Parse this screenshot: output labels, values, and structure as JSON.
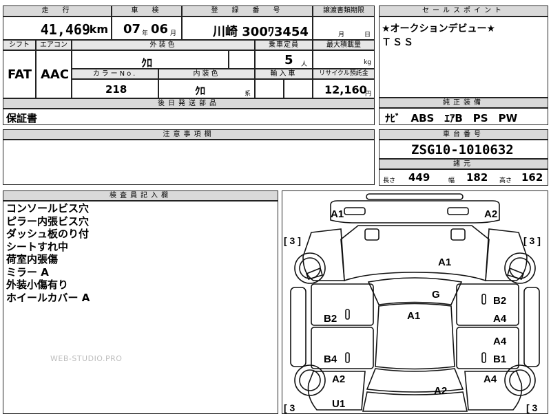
{
  "headers": {
    "mileage": "走　行",
    "inspection": "車　検",
    "registration": "登　録　番　号",
    "transfer_deadline": "譲渡書類期限",
    "sales_point": "セールスポイント",
    "shift": "シフト",
    "aircon": "エアコン",
    "exterior_color": "外装色",
    "capacity": "乗車定員",
    "max_load": "最大積載量",
    "color_no": "カラーNo.",
    "interior_color": "内装色",
    "import": "輸入車",
    "recycle": "リサイクル預託金",
    "follow_up_parts": "後日発送部品",
    "genuine_equipment": "純正装備",
    "notes": "注意事項欄",
    "chassis_no": "車台番号",
    "specs": "諸元",
    "inspector_notes": "検査員記入欄"
  },
  "vehicle": {
    "mileage": "41,469",
    "mileage_unit": "km",
    "inspection_year": "07",
    "inspection_year_unit": "年",
    "inspection_month": "06",
    "inspection_month_unit": "月",
    "registration": "川崎 300ﾜ3454",
    "deadline_month_unit": "月",
    "deadline_day_unit": "日",
    "shift": "FAT",
    "aircon": "AAC",
    "exterior_color": "ｸﾛ",
    "capacity": "5",
    "capacity_unit": "人",
    "max_load_unit": "kg",
    "color_no": "218",
    "interior_color": "ｸﾛ",
    "interior_suffix": "系",
    "recycle": "12,160",
    "recycle_unit": "円",
    "follow_up_parts": "保証書",
    "chassis_no": "ZSG10-1010632",
    "length_label": "長さ",
    "length": "449",
    "width_label": "幅",
    "width": "182",
    "height_label": "高さ",
    "height": "162"
  },
  "sales_points": [
    "★オークションデビュー★",
    "ＴＳＳ"
  ],
  "genuine_equipment": "ﾅﾋﾞ　ABS　ｴｱB　PS　PW",
  "inspector_notes": [
    "コンソールビス穴",
    "ピラー内張ビス穴",
    "ダッシュ板のり付",
    "シートすれ中",
    "荷室内張傷",
    "ミラー A",
    "外装小傷有り",
    "ホイールカバー A"
  ],
  "watermark": "WEB-STUDIO.PRO",
  "diagram": {
    "labels": {
      "a1_front_left": "A1",
      "a2_front_right": "A2",
      "tire_fl": "[ 3 ]",
      "tire_fr": "[ 3 ]",
      "tire_rl": "[ 3",
      "tire_rr": "[ 3",
      "hood": "A1",
      "windshield": "G",
      "roof": "A1",
      "front_door_l": "B2",
      "front_door_r_b": "B2",
      "front_door_r_a": "A4",
      "rear_door_l": "B4",
      "rear_door_r_a": "A4",
      "rear_door_r_b": "B1",
      "rear_fender_l": "A2",
      "rear_fender_r": "A4",
      "trunk": "A2",
      "rear_bumper": "U1"
    }
  }
}
